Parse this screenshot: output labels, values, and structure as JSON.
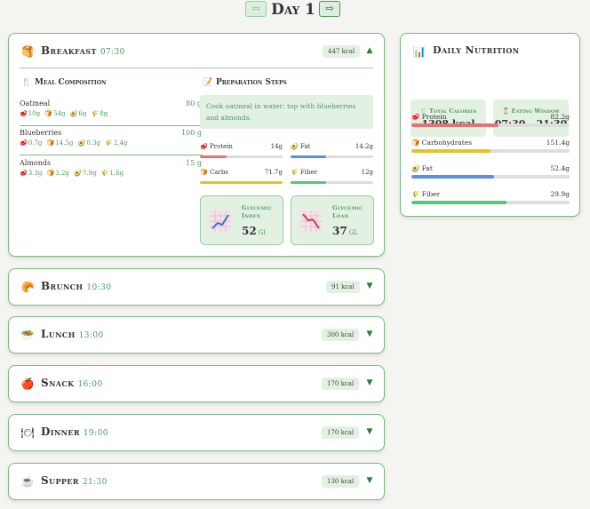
{
  "nav": {
    "prev_icon": "⇦",
    "next_icon": "⇨",
    "title": "Day 1"
  },
  "breakfast": {
    "icon": "🥞",
    "name": "Breakfast",
    "time": "07:30",
    "kcal": "447 kcal",
    "chevron": "▲",
    "meal_composition_title": "Meal Composition",
    "meal_composition_icon": "🍴",
    "foods": [
      {
        "name": "Oatmeal",
        "grams": "80 g",
        "protein": "10g",
        "carbs": "54g",
        "fat": "6g",
        "fiber": "8g"
      },
      {
        "name": "Blueberries",
        "grams": "100 g",
        "protein": "0.7g",
        "carbs": "14.5g",
        "fat": "0.3g",
        "fiber": "2.4g"
      },
      {
        "name": "Almonds",
        "grams": "15 g",
        "protein": "3.3g",
        "carbs": "3.2g",
        "fat": "7.9g",
        "fiber": "1.6g"
      }
    ],
    "prep_title": "Preparation Steps",
    "prep_icon": "📝",
    "prep_text": "Cook oatmeal in water; top with blueberries and almonds.",
    "macros": [
      {
        "key": "protein",
        "label": "Protein",
        "value": "14g",
        "icon": "🥩",
        "fill": 0.32,
        "color": "#e57373"
      },
      {
        "key": "fat",
        "label": "Fat",
        "value": "14.2g",
        "icon": "🥑",
        "fill": 0.43,
        "color": "#5b8fe0"
      },
      {
        "key": "carbs",
        "label": "Carbs",
        "value": "71.7g",
        "icon": "🍞",
        "fill": 1.0,
        "color": "#e6c229"
      },
      {
        "key": "fiber",
        "label": "Fiber",
        "value": "12g",
        "icon": "🌾",
        "fill": 0.43,
        "color": "#4fc97a"
      }
    ],
    "glycemic_index": {
      "label": "Glycemic Index",
      "value": "52",
      "unit": "GI"
    },
    "glycemic_load": {
      "label": "Glycemic Load",
      "value": "37",
      "unit": "GL"
    }
  },
  "meals": [
    {
      "id": "brunch",
      "icon": "🥐",
      "name": "Brunch",
      "time": "10:30",
      "kcal": "91 kcal",
      "chevron": "▼"
    },
    {
      "id": "lunch",
      "icon": "🥗",
      "name": "Lunch",
      "time": "13:00",
      "kcal": "300 kcal",
      "chevron": "▼"
    },
    {
      "id": "snack",
      "icon": "🍎",
      "name": "Snack",
      "time": "16:00",
      "kcal": "170 kcal",
      "chevron": "▼"
    },
    {
      "id": "dinner",
      "icon": "🍽",
      "name": "Dinner",
      "time": "19:00",
      "kcal": "170 kcal",
      "chevron": "▼"
    },
    {
      "id": "supper",
      "icon": "☕",
      "name": "Supper",
      "time": "21:30",
      "kcal": "130 kcal",
      "chevron": "▼"
    }
  ],
  "daily": {
    "icon": "📊",
    "title": "Daily Nutrition",
    "total_label": "Total Calories",
    "total_icon": "🍴",
    "total_value": "1308 kcal",
    "window_label": "Eating Window",
    "window_icon": "⏳",
    "window_value": "07:30 - 21:30",
    "items": [
      {
        "label": "Protein",
        "value": "82.2g",
        "icon": "🥩",
        "fill": 0.55,
        "color": "#e57373"
      },
      {
        "label": "Carbohydrates",
        "value": "151.4g",
        "icon": "🍞",
        "fill": 0.5,
        "color": "#e6c229"
      },
      {
        "label": "Fat",
        "value": "52.4g",
        "icon": "🥑",
        "fill": 0.52,
        "color": "#5b8fe0"
      },
      {
        "label": "Fiber",
        "value": "29.9g",
        "icon": "🌾",
        "fill": 0.6,
        "color": "#4fc97a"
      }
    ]
  }
}
